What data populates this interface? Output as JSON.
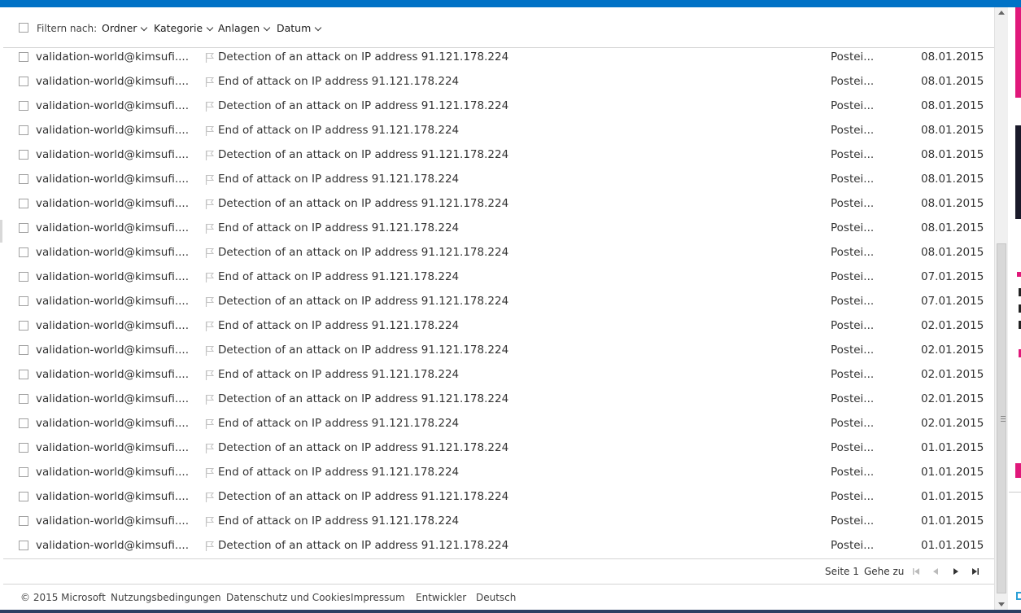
{
  "filter_bar": {
    "label": "Filtern nach:",
    "dropdowns": [
      "Ordner",
      "Kategorie",
      "Anlagen",
      "Datum"
    ]
  },
  "messages": [
    {
      "sender": "validation-world@kimsufi....",
      "subject": "Detection of an attack on IP address 91.121.178.224",
      "folder": "Postei...",
      "date": "08.01.2015"
    },
    {
      "sender": "validation-world@kimsufi....",
      "subject": "End of attack on IP address 91.121.178.224",
      "folder": "Postei...",
      "date": "08.01.2015"
    },
    {
      "sender": "validation-world@kimsufi....",
      "subject": "Detection of an attack on IP address 91.121.178.224",
      "folder": "Postei...",
      "date": "08.01.2015"
    },
    {
      "sender": "validation-world@kimsufi....",
      "subject": "End of attack on IP address 91.121.178.224",
      "folder": "Postei...",
      "date": "08.01.2015"
    },
    {
      "sender": "validation-world@kimsufi....",
      "subject": "Detection of an attack on IP address 91.121.178.224",
      "folder": "Postei...",
      "date": "08.01.2015"
    },
    {
      "sender": "validation-world@kimsufi....",
      "subject": "End of attack on IP address 91.121.178.224",
      "folder": "Postei...",
      "date": "08.01.2015"
    },
    {
      "sender": "validation-world@kimsufi....",
      "subject": "Detection of an attack on IP address 91.121.178.224",
      "folder": "Postei...",
      "date": "08.01.2015"
    },
    {
      "sender": "validation-world@kimsufi....",
      "subject": "End of attack on IP address 91.121.178.224",
      "folder": "Postei...",
      "date": "08.01.2015"
    },
    {
      "sender": "validation-world@kimsufi....",
      "subject": "Detection of an attack on IP address 91.121.178.224",
      "folder": "Postei...",
      "date": "08.01.2015"
    },
    {
      "sender": "validation-world@kimsufi....",
      "subject": "End of attack on IP address 91.121.178.224",
      "folder": "Postei...",
      "date": "07.01.2015"
    },
    {
      "sender": "validation-world@kimsufi....",
      "subject": "Detection of an attack on IP address 91.121.178.224",
      "folder": "Postei...",
      "date": "07.01.2015"
    },
    {
      "sender": "validation-world@kimsufi....",
      "subject": "End of attack on IP address 91.121.178.224",
      "folder": "Postei...",
      "date": "02.01.2015"
    },
    {
      "sender": "validation-world@kimsufi....",
      "subject": "Detection of an attack on IP address 91.121.178.224",
      "folder": "Postei...",
      "date": "02.01.2015"
    },
    {
      "sender": "validation-world@kimsufi....",
      "subject": "End of attack on IP address 91.121.178.224",
      "folder": "Postei...",
      "date": "02.01.2015"
    },
    {
      "sender": "validation-world@kimsufi....",
      "subject": "Detection of an attack on IP address 91.121.178.224",
      "folder": "Postei...",
      "date": "02.01.2015"
    },
    {
      "sender": "validation-world@kimsufi....",
      "subject": "End of attack on IP address 91.121.178.224",
      "folder": "Postei...",
      "date": "02.01.2015"
    },
    {
      "sender": "validation-world@kimsufi....",
      "subject": "Detection of an attack on IP address 91.121.178.224",
      "folder": "Postei...",
      "date": "01.01.2015"
    },
    {
      "sender": "validation-world@kimsufi....",
      "subject": "End of attack on IP address 91.121.178.224",
      "folder": "Postei...",
      "date": "01.01.2015"
    },
    {
      "sender": "validation-world@kimsufi....",
      "subject": "Detection of an attack on IP address 91.121.178.224",
      "folder": "Postei...",
      "date": "01.01.2015"
    },
    {
      "sender": "validation-world@kimsufi....",
      "subject": "End of attack on IP address 91.121.178.224",
      "folder": "Postei...",
      "date": "01.01.2015"
    },
    {
      "sender": "validation-world@kimsufi....",
      "subject": "Detection of an attack on IP address 91.121.178.224",
      "folder": "Postei...",
      "date": "01.01.2015"
    }
  ],
  "pager": {
    "page_label": "Seite 1",
    "goto_label": "Gehe zu"
  },
  "footer": {
    "links": [
      "© 2015 Microsoft",
      "Nutzungsbedingungen",
      "Datenschutz und Cookies",
      "Impressum",
      "Entwickler",
      "Deutsch"
    ]
  },
  "icons": {
    "flag": "flag-icon",
    "dropdown": "chevron-down-icon",
    "first_page": "first-page-icon",
    "previous_page": "previous-page-icon",
    "next_page": "next-page-icon",
    "last_page": "last-page-icon"
  },
  "colors": {
    "accent": "#0072c6",
    "side_ad": "#e0187a"
  }
}
